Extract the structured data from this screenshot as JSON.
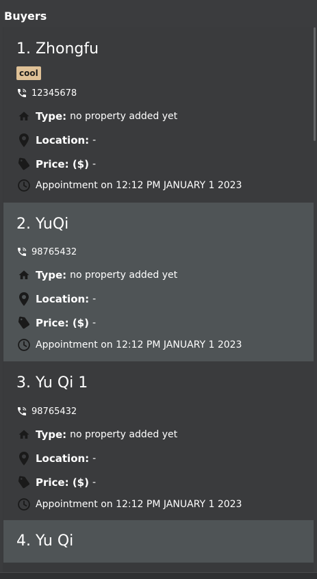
{
  "panel": {
    "title": "Buyers"
  },
  "buyers": [
    {
      "name": "1.  Zhongfu",
      "tag": "cool",
      "phone": "12345678",
      "type_label": "Type:",
      "type_value": "no property added yet",
      "location_label": "Location:",
      "location_value": "-",
      "price_label": "Price: ($)",
      "price_value": "-",
      "appointment": "Appointment on 12:12 PM JANUARY 1 2023"
    },
    {
      "name": "2.  YuQi",
      "phone": "98765432",
      "type_label": "Type:",
      "type_value": "no property added yet",
      "location_label": "Location:",
      "location_value": "-",
      "price_label": "Price: ($)",
      "price_value": "-",
      "appointment": "Appointment on 12:12 PM JANUARY 1 2023"
    },
    {
      "name": "3.  Yu Qi 1",
      "phone": "98765432",
      "type_label": "Type:",
      "type_value": "no property added yet",
      "location_label": "Location:",
      "location_value": "-",
      "price_label": "Price: ($)",
      "price_value": "-",
      "appointment": "Appointment on 12:12 PM JANUARY 1 2023"
    },
    {
      "name": "4.  Yu Qi"
    }
  ],
  "icons": {
    "phone": "phone-icon",
    "type": "home-icon",
    "location": "location-pin-icon",
    "price": "price-tag-icon",
    "appointment": "clock-icon"
  }
}
